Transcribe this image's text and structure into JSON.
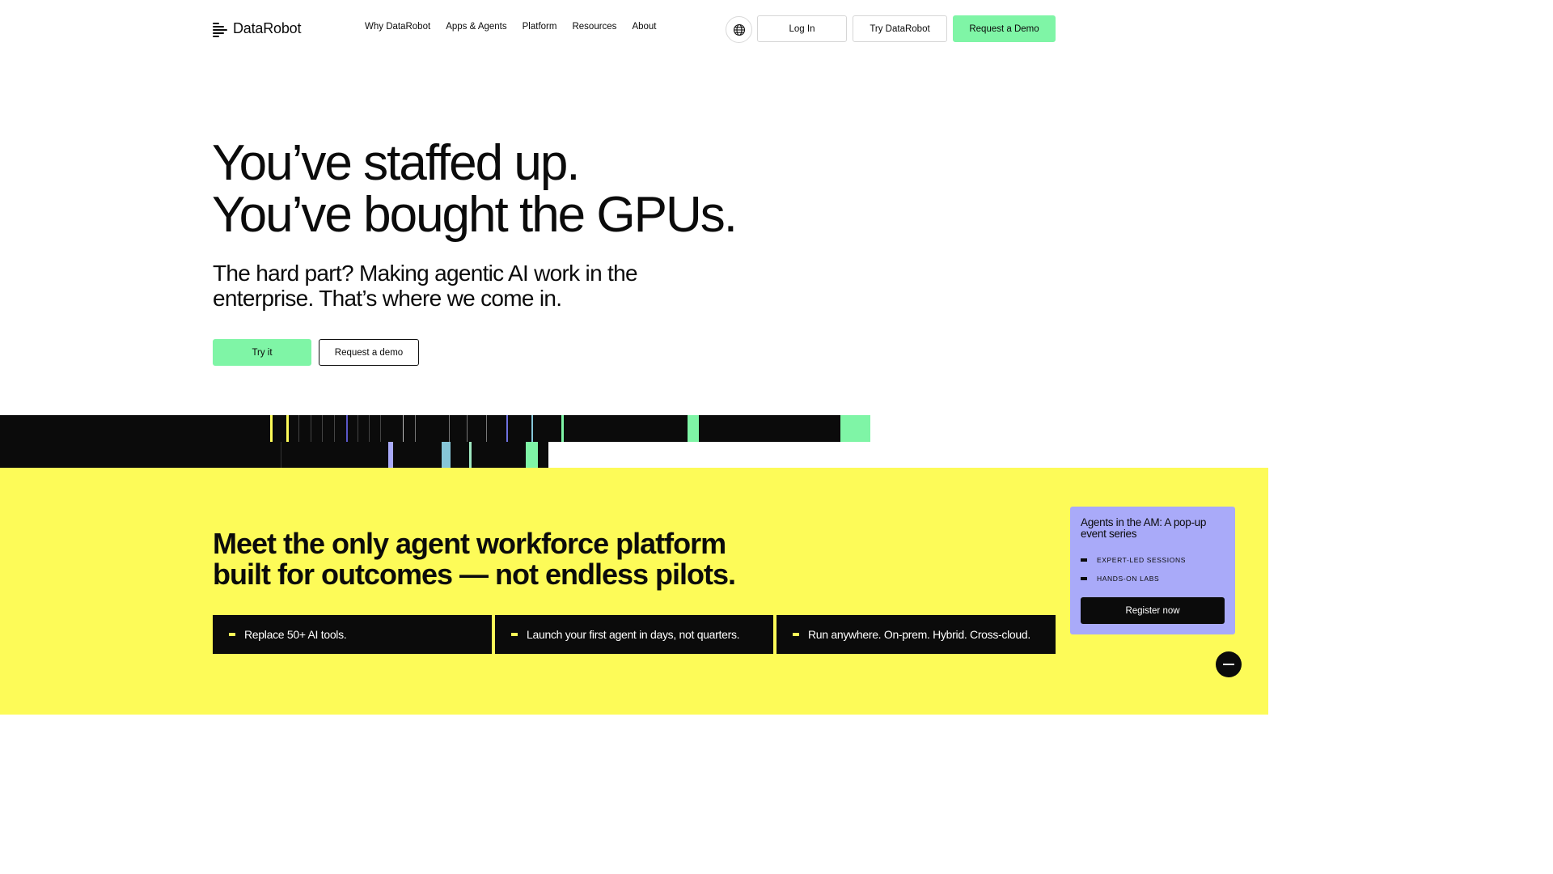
{
  "header": {
    "logo_text": "DataRobot",
    "nav": [
      "Why DataRobot",
      "Apps & Agents",
      "Platform",
      "Resources",
      "About"
    ],
    "language_icon": "globe-icon",
    "login_label": "Log In",
    "try_label": "Try DataRobot",
    "demo_label": "Request a Demo"
  },
  "hero": {
    "title_line1": "You’ve staffed up.",
    "title_line2": "You’ve bought the GPUs.",
    "subtitle": "The hard part? Making agentic AI work in the enterprise. That’s where we come in.",
    "cta_primary": "Try it",
    "cta_secondary": "Request a demo"
  },
  "outcomes": {
    "title": "Meet the only agent workforce platform built for outcomes — not endless pilots.",
    "cards": [
      "Replace 50+ AI tools.",
      "Launch your first agent in days, not quarters.",
      "Run anywhere. On-prem. Hybrid. Cross-cloud."
    ]
  },
  "promo": {
    "title": "Agents in the AM: A pop-up event series",
    "items": [
      "EXPERT-LED SESSIONS",
      "HANDS-ON LABS"
    ],
    "button": "Register now"
  },
  "colors": {
    "accent_green": "#7ff5a6",
    "yellow": "#fdfb58",
    "lavender": "#a9aaf9",
    "black": "#0b0b0b"
  }
}
